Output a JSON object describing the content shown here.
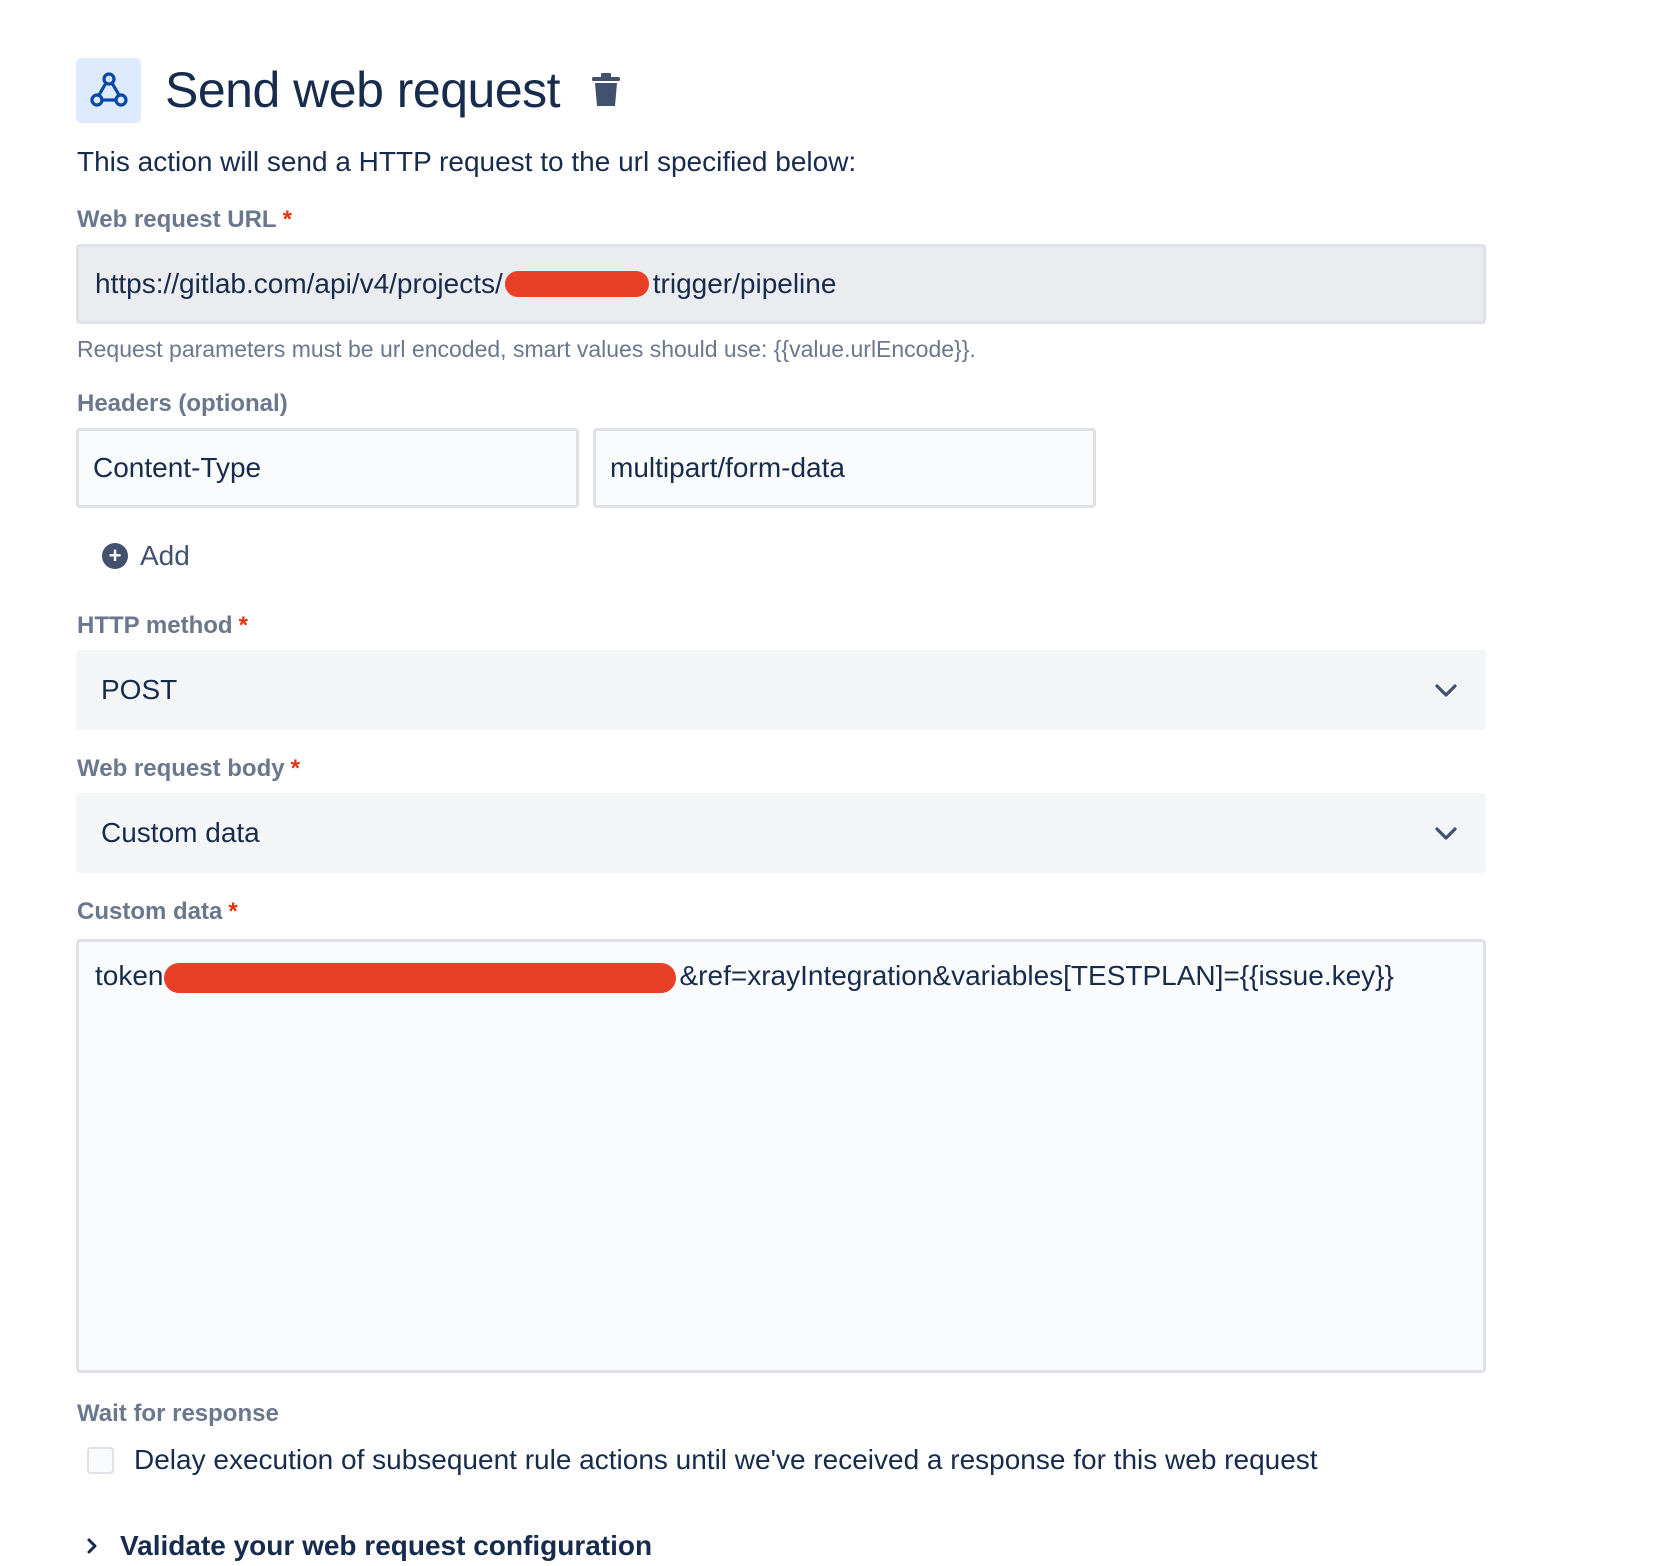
{
  "header": {
    "title": "Send web request",
    "icon": "webhook-icon",
    "delete_icon": "trash-icon",
    "icon_bg": "#deebff",
    "icon_color": "#0747a6"
  },
  "description": "This action will send a HTTP request to the url specified below:",
  "url_field": {
    "label": "Web request URL",
    "required_mark": "*",
    "value_prefix": "https://gitlab.com/api/v4/projects/",
    "value_suffix": "trigger/pipeline",
    "hint": "Request parameters must be url encoded, smart values should use: {{value.urlEncode}}."
  },
  "headers": {
    "label": "Headers (optional)",
    "key": "Content-Type",
    "value": "multipart/form-data",
    "add_label": "Add"
  },
  "http_method": {
    "label": "HTTP method",
    "required_mark": "*",
    "selected": "POST"
  },
  "body": {
    "label": "Web request body",
    "required_mark": "*",
    "selected": "Custom data"
  },
  "custom_data": {
    "label": "Custom data",
    "required_mark": "*",
    "value_prefix": "token",
    "value_suffix": "&ref=xrayIntegration&variables[TESTPLAN]={{issue.key}}"
  },
  "wait": {
    "label": "Wait for response",
    "checkbox_label": "Delay execution of subsequent rule actions until we've received a response for this web request",
    "checked": false
  },
  "validate": {
    "label": "Validate your web request configuration"
  },
  "colors": {
    "text": "#172b4d",
    "label": "#6b778c",
    "required": "#de350b",
    "redaction": "#e83f26"
  }
}
